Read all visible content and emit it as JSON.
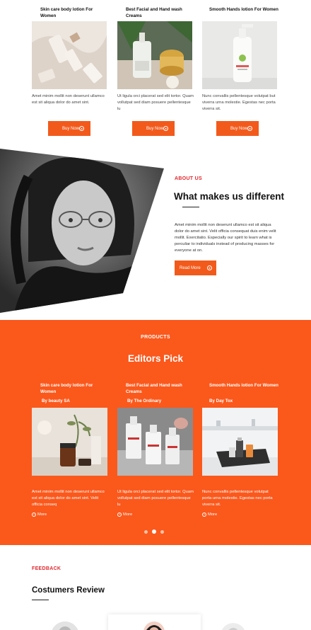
{
  "top_products": [
    {
      "title": "Skin care body lotion For Women",
      "desc": "Amet minim mollit non deserunt ullamco est sit aliqua dolor do amet sint.",
      "button": "Buy Now"
    },
    {
      "title": "Best Facial and Hand wash Creams",
      "desc": "Ut ligula orci placerat sed elit tortor. Quam vollutpat sed diam posuere pellentesque lu",
      "button": "Buy Now"
    },
    {
      "title": "Smooth Hands lotion For Women",
      "desc": "Nunc convallis pellentesque volutpat but viverra urna molestie. Egestas nec porta viverra sit.",
      "button": "Buy Now"
    }
  ],
  "about": {
    "label": "ABOUT US",
    "heading": "What makes  us different",
    "text": "Amet minim mollit non deserunt ullamco est sit aliqua dolor do amet sint. Velit officia consequat duis enim velit mollit. Exercitatio. Especially our spirit to learn what is perculiar to individuals instead of producing masses for everyone at on.",
    "button": "Read More"
  },
  "products": {
    "label": "PRODUCTS",
    "heading": "Editors Pick",
    "items": [
      {
        "title": "Skin care body lotion For Women",
        "brand": "By beauty SA",
        "desc": "Amet minim mollit non deserunt ullamco est sit aliqua dolor do amet sint. Velit officia conseq",
        "more": "More"
      },
      {
        "title": "Best Facial and Hand wash Creams",
        "brand": "By The Ordinary",
        "desc": "Ut ligula orci placerat sed elit tortor. Quam vollutpat sed diam posuere pellentesque lu",
        "more": "More"
      },
      {
        "title": "Smooth Hands lotion For Women",
        "brand": "By Day Tox",
        "desc": "Nunc convallis pellentesque volutpat porta urna molestie. Egestas nec porta viverra sit.",
        "more": "More"
      }
    ]
  },
  "feedback": {
    "label": "FEEDBACK",
    "heading": "Costumers Review"
  },
  "colors": {
    "accent": "#fb581c",
    "button": "#f25a1c",
    "label_red": "#e4262c"
  },
  "icons": {
    "button_arrow": "arrow-right-circle-icon",
    "more": "plus-circle-icon"
  }
}
